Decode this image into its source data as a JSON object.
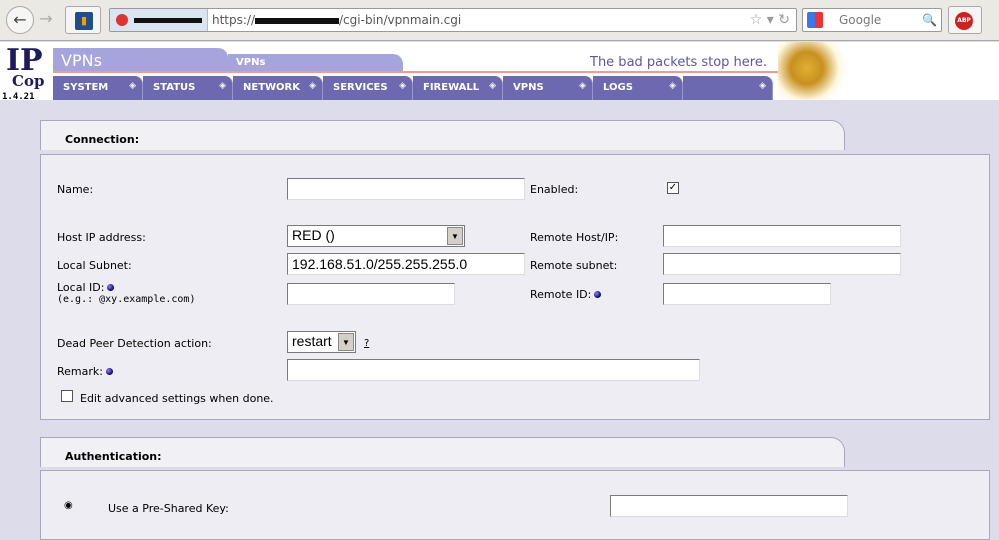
{
  "browser": {
    "url_prefix": "https://",
    "url_suffix": "/cgi-bin/vpnmain.cgi",
    "search_placeholder": "Google",
    "abp": "ABP"
  },
  "header": {
    "logo": "IPCop",
    "version": "1.4.21",
    "page_title": "VPNs",
    "sub_tab": "VPNs",
    "slogan": "The bad packets stop here."
  },
  "nav": [
    {
      "label": "System"
    },
    {
      "label": "Status"
    },
    {
      "label": "Network"
    },
    {
      "label": "Services"
    },
    {
      "label": "Firewall"
    },
    {
      "label": "VPNs"
    },
    {
      "label": "Logs"
    },
    {
      "label": ""
    }
  ],
  "connection": {
    "title": "Connection:",
    "name_label": "Name:",
    "name_value": "",
    "enabled_label": "Enabled:",
    "enabled": true,
    "host_ip_label": "Host IP address:",
    "host_ip_value": "RED ()",
    "remote_host_label": "Remote Host/IP:",
    "remote_host_value": "",
    "local_subnet_label": "Local Subnet:",
    "local_subnet_value": "192.168.51.0/255.255.255.0",
    "remote_subnet_label": "Remote subnet:",
    "remote_subnet_value": "",
    "local_id_label": "Local ID:",
    "local_id_hint": "(e.g.: @xy.example.com)",
    "local_id_value": "",
    "remote_id_label": "Remote ID:",
    "remote_id_value": "",
    "dpd_label": "Dead Peer Detection action:",
    "dpd_value": "restart",
    "help": "?",
    "remark_label": "Remark:",
    "remark_value": "",
    "advanced_label": "Edit advanced settings when done.",
    "advanced": false
  },
  "authentication": {
    "title": "Authentication:",
    "psk_label": "Use a Pre-Shared Key:",
    "psk_selected": true,
    "psk_value": ""
  }
}
